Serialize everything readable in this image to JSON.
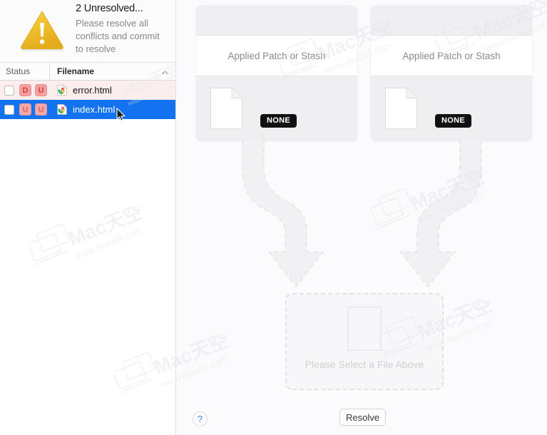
{
  "sidebar": {
    "banner": {
      "icon": "warning-triangle-icon",
      "title": "2 Unresolved...",
      "subtitle": "Please resolve all conflicts and commit to resolve"
    },
    "table": {
      "columns": [
        {
          "key": "status",
          "label": "Status"
        },
        {
          "key": "filename",
          "label": "Filename",
          "sorted": "asc",
          "sort_icon": "chevron-up-icon"
        }
      ],
      "rows": [
        {
          "checked": false,
          "badges": [
            "D",
            "U"
          ],
          "icon": "chrome-html-file-icon",
          "filename": "error.html",
          "selected": false,
          "conflict": true
        },
        {
          "checked": false,
          "badges": [
            "U",
            "U"
          ],
          "icon": "chrome-html-file-icon",
          "filename": "index.html",
          "selected": true,
          "conflict": true
        }
      ]
    }
  },
  "main": {
    "panels": [
      {
        "label": "Applied Patch or Stash",
        "badge": "NONE",
        "doc_icon": "blank-document-icon"
      },
      {
        "label": "Applied Patch or Stash",
        "badge": "NONE",
        "doc_icon": "blank-document-icon"
      }
    ],
    "dropzone": {
      "label": "Please Select a File Above",
      "doc_icon": "blank-document-outline-icon"
    },
    "footer": {
      "help_label": "?",
      "resolve_label": "Resolve"
    }
  },
  "colors": {
    "selection_blue": "#1272ef",
    "conflict_row": "#fdeeee",
    "badge_bg": "#f4a0a0",
    "badge_text": "#d93b3b",
    "warning_yellow": "#eec02e",
    "pill_black": "#111113",
    "help_blue": "#3d7ff0"
  },
  "watermark": {
    "text": "Mac天空",
    "url": "www.mac69.com"
  }
}
